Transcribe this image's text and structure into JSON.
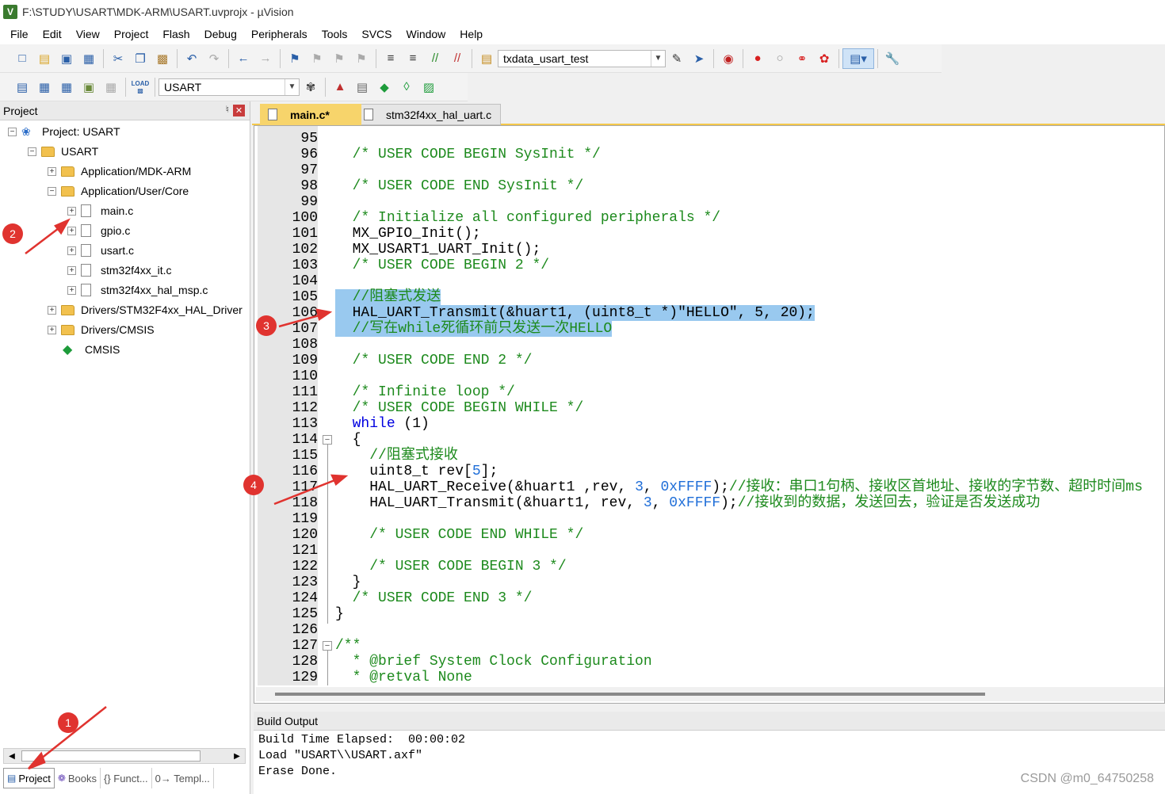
{
  "window": {
    "title": "F:\\STUDY\\USART\\MDK-ARM\\USART.uvprojx - µVision",
    "icon_letter": "V"
  },
  "menu": [
    "File",
    "Edit",
    "View",
    "Project",
    "Flash",
    "Debug",
    "Peripherals",
    "Tools",
    "SVCS",
    "Window",
    "Help"
  ],
  "toolbar1": {
    "target_combo": "txdata_usart_test"
  },
  "toolbar2": {
    "project_combo": "USART",
    "load_label": "LOAD"
  },
  "project_pane": {
    "title": "Project",
    "tree": [
      "Project: USART",
      "USART",
      "Application/MDK-ARM",
      "Application/User/Core",
      "main.c",
      "gpio.c",
      "usart.c",
      "stm32f4xx_it.c",
      "stm32f4xx_hal_msp.c",
      "Drivers/STM32F4xx_HAL_Driver",
      "Drivers/CMSIS",
      "CMSIS"
    ],
    "bottom_tabs": [
      "Project",
      "Books",
      "{} Funct...",
      "0→ Templ..."
    ]
  },
  "editor": {
    "tabs": [
      "main.c*",
      "stm32f4xx_hal_uart.c"
    ],
    "lines": [
      {
        "n": "95",
        "code": ""
      },
      {
        "n": "96",
        "code": "  /* USER CODE BEGIN SysInit */"
      },
      {
        "n": "97",
        "code": ""
      },
      {
        "n": "98",
        "code": "  /* USER CODE END SysInit */"
      },
      {
        "n": "99",
        "code": ""
      },
      {
        "n": "100",
        "code": "  /* Initialize all configured peripherals */"
      },
      {
        "n": "101",
        "code": "  MX_GPIO_Init();"
      },
      {
        "n": "102",
        "code": "  MX_USART1_UART_Init();"
      },
      {
        "n": "103",
        "code": "  /* USER CODE BEGIN 2 */"
      },
      {
        "n": "104",
        "code": ""
      },
      {
        "n": "105",
        "code": "  //阻塞式发送"
      },
      {
        "n": "106",
        "code": "  HAL_UART_Transmit(&huart1, (uint8_t *)\"HELLO\", 5, 20);"
      },
      {
        "n": "107",
        "code": "  //写在while死循环前只发送一次HELLO"
      },
      {
        "n": "108",
        "code": ""
      },
      {
        "n": "109",
        "code": "  /* USER CODE END 2 */"
      },
      {
        "n": "110",
        "code": ""
      },
      {
        "n": "111",
        "code": "  /* Infinite loop */"
      },
      {
        "n": "112",
        "code": "  /* USER CODE BEGIN WHILE */"
      },
      {
        "n": "113",
        "code": "  while (1)"
      },
      {
        "n": "114",
        "code": "  {"
      },
      {
        "n": "115",
        "code": "    //阻塞式接收"
      },
      {
        "n": "116",
        "code": "    uint8_t rev[5];"
      },
      {
        "n": "117",
        "code": "    HAL_UART_Receive(&huart1 ,rev, 3, 0xFFFF);//接收：串口1句柄、接收区首地址、接收的字节数、超时时间ms"
      },
      {
        "n": "118",
        "code": "    HAL_UART_Transmit(&huart1, rev, 3, 0xFFFF);//接收到的数据，发送回去，验证是否发送成功"
      },
      {
        "n": "119",
        "code": ""
      },
      {
        "n": "120",
        "code": "    /* USER CODE END WHILE */"
      },
      {
        "n": "121",
        "code": ""
      },
      {
        "n": "122",
        "code": "    /* USER CODE BEGIN 3 */"
      },
      {
        "n": "123",
        "code": "  }"
      },
      {
        "n": "124",
        "code": "  /* USER CODE END 3 */"
      },
      {
        "n": "125",
        "code": "}"
      },
      {
        "n": "126",
        "code": ""
      },
      {
        "n": "127",
        "code": "/**"
      },
      {
        "n": "128",
        "code": "  * @brief System Clock Configuration"
      },
      {
        "n": "129",
        "code": "  * @retval None"
      }
    ]
  },
  "build_output": {
    "title": "Build Output",
    "lines": [
      "Build Time Elapsed:  00:00:02",
      "Load \"USART\\\\USART.axf\"",
      "Erase Done."
    ]
  },
  "annotations": [
    "1",
    "2",
    "3",
    "4"
  ],
  "watermark": "CSDN @m0_64750258",
  "colors": {
    "highlight": "#99c9ef",
    "comment": "#1d8a1d",
    "keyword": "#0000e0",
    "badge": "#e0332f",
    "active_tab": "#f7d46b"
  }
}
